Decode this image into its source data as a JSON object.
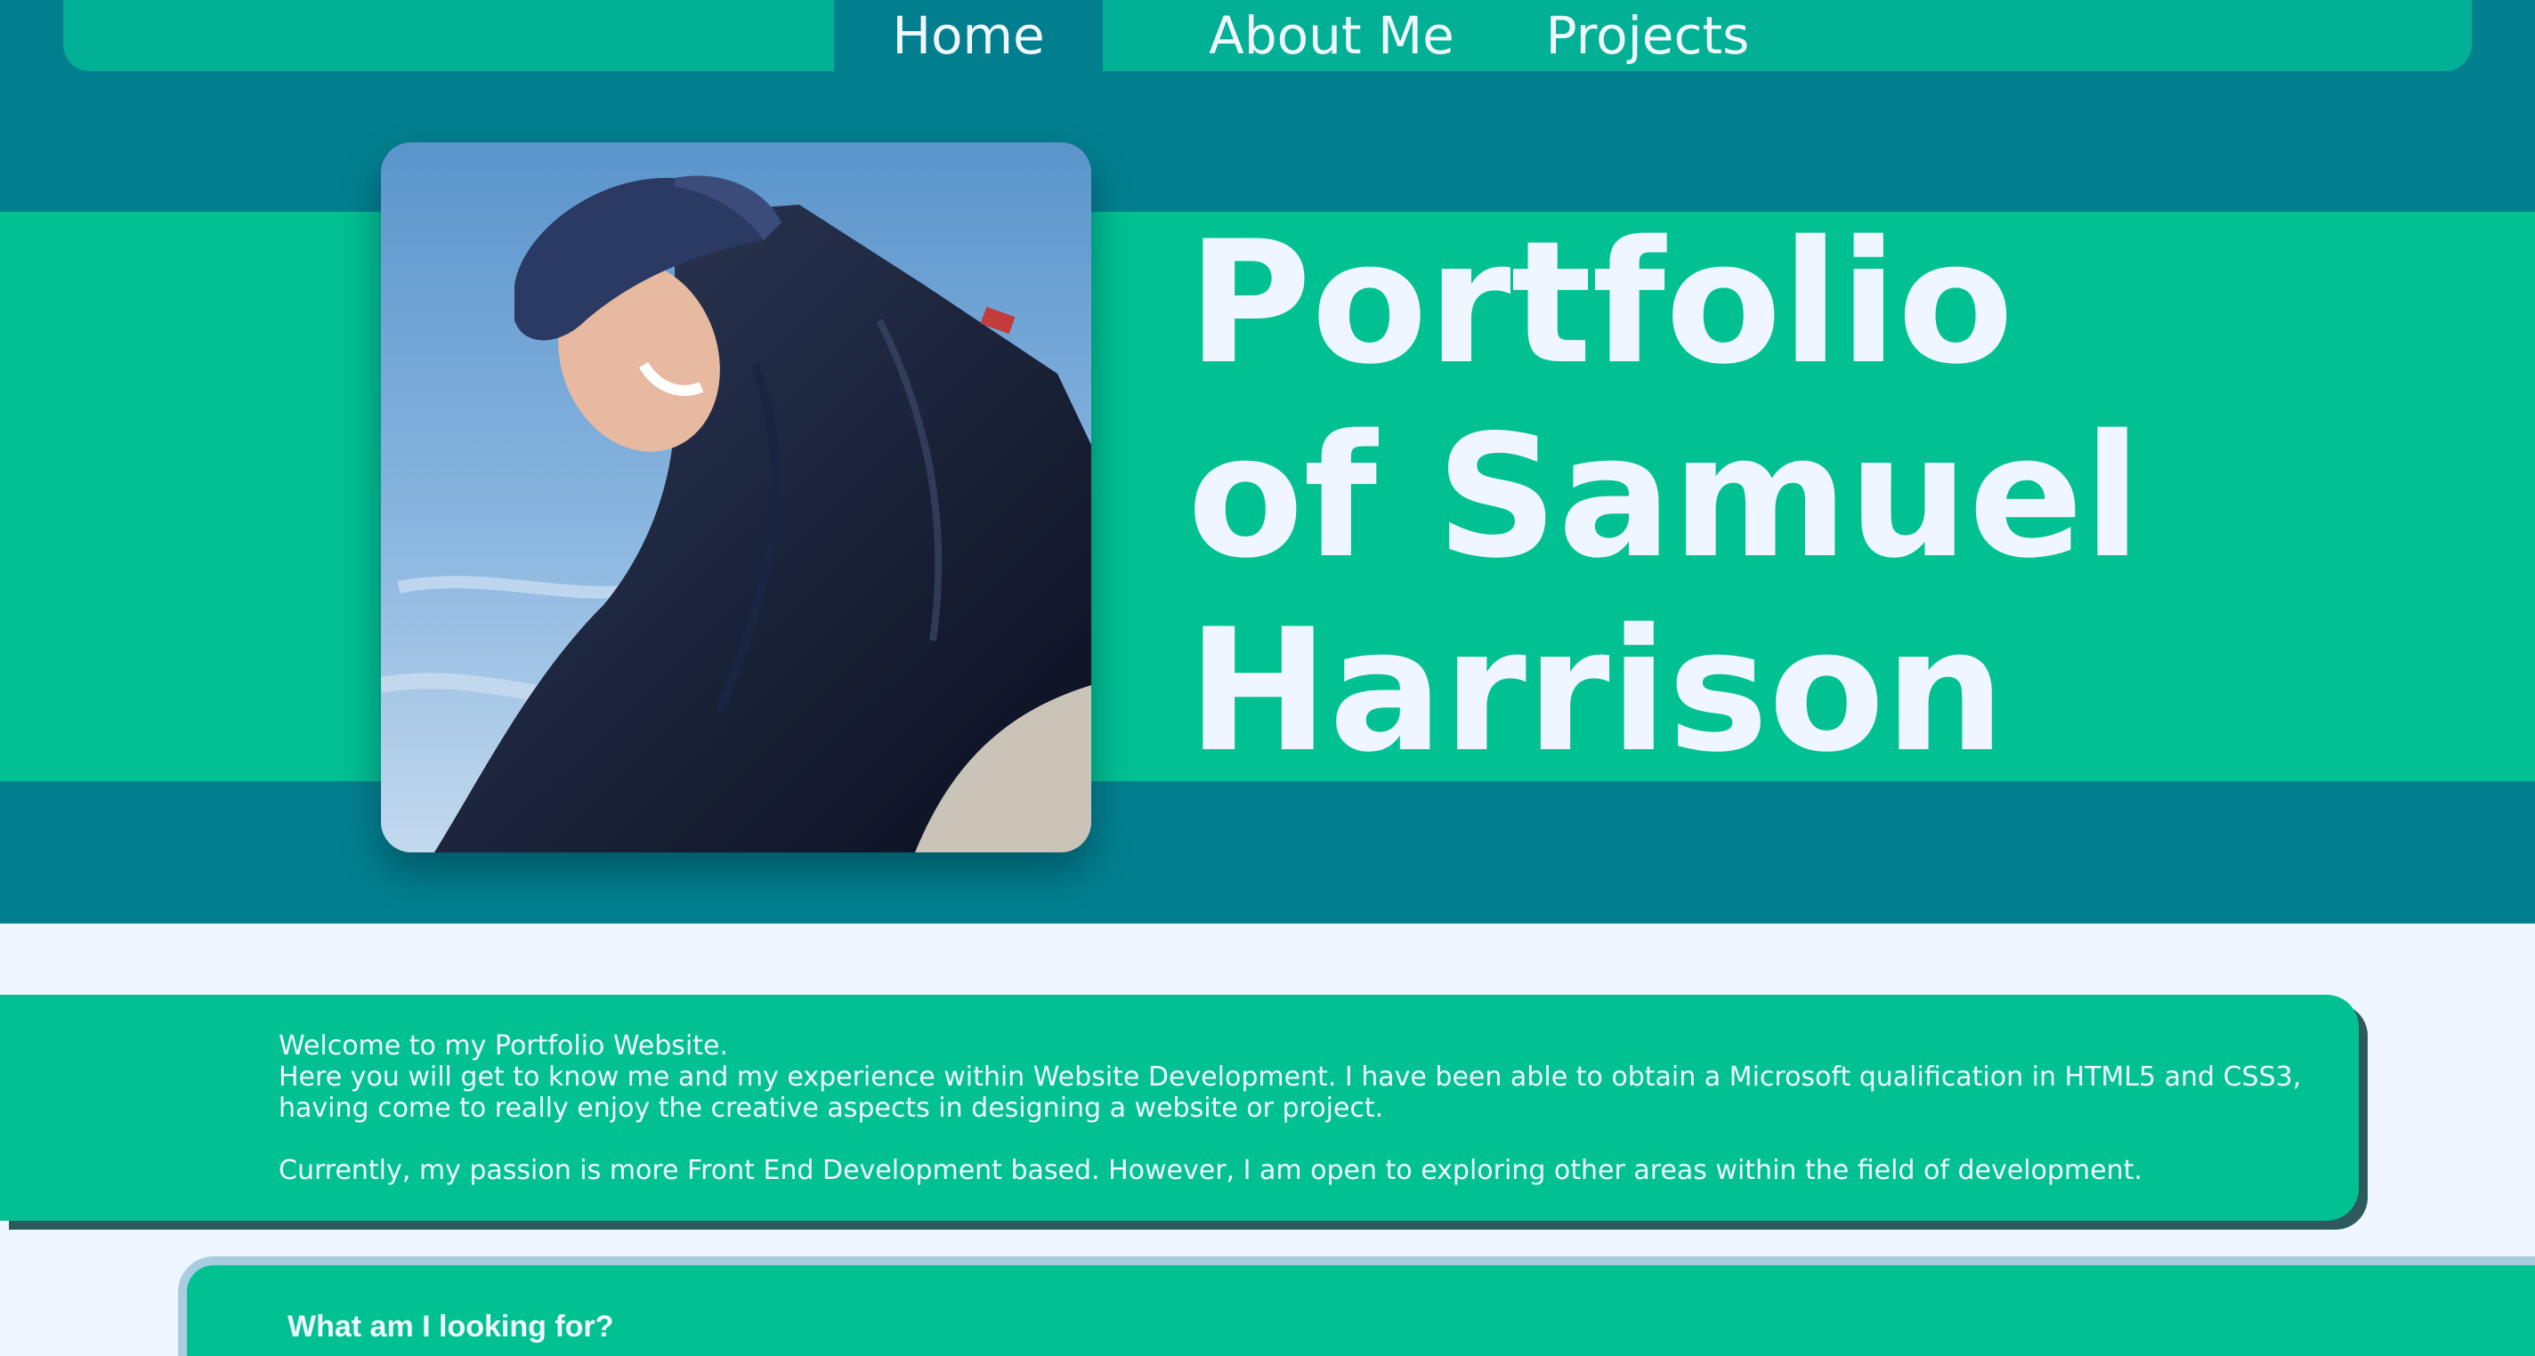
{
  "nav": {
    "items": [
      {
        "label": "Home",
        "active": true
      },
      {
        "label": "About Me",
        "active": false
      },
      {
        "label": "Projects",
        "active": false
      }
    ]
  },
  "hero": {
    "title_line1": "Portfolio",
    "title_line2": "of Samuel",
    "title_line3": "Harrison"
  },
  "welcome": {
    "line1": "Welcome to my Portfolio Website.",
    "line2": "Here you will get to know me and my experience within Website Development. I have been able to obtain a Microsoft qualification in HTML5 and CSS3, having come to really enjoy the creative aspects in designing a website or project.",
    "line3": "Currently, my passion is more Front End Development based. However, I am open to exploring other areas within the field of development."
  },
  "looking": {
    "heading": "What am I looking for?"
  },
  "colors": {
    "dark_teal": "#027f8f",
    "teal": "#01b095",
    "green": "#01c193",
    "light": "#eff6ff"
  }
}
